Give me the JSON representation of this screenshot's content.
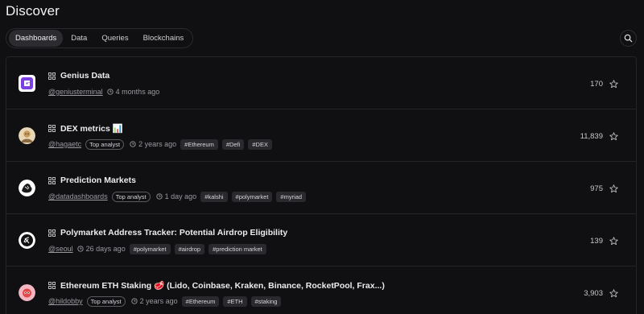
{
  "header": {
    "title": "Discover"
  },
  "tabs": [
    {
      "label": "Dashboards",
      "active": true
    },
    {
      "label": "Data",
      "active": false
    },
    {
      "label": "Queries",
      "active": false
    },
    {
      "label": "Blockchains",
      "active": false
    }
  ],
  "search": {
    "icon": "search-icon"
  },
  "rows": [
    {
      "name": "Genius Data",
      "user": "@geniusterminal",
      "badge": "",
      "time": "4 months ago",
      "tags": [],
      "stars": "170",
      "avatar_color": "#7b3fe4"
    },
    {
      "name": "DEX metrics 📊",
      "user": "@hagaetc",
      "badge": "Top analyst",
      "time": "2 years ago",
      "tags": [
        "#Ethereum",
        "#Defi",
        "#DEX"
      ],
      "stars": "11,839",
      "avatar_color": "#c79a5b"
    },
    {
      "name": "Prediction Markets",
      "user": "@datadashboards",
      "badge": "Top analyst",
      "time": "1 day ago",
      "tags": [
        "#kalshi",
        "#polymarket",
        "#myriad"
      ],
      "stars": "975",
      "avatar_color": "#ffffff"
    },
    {
      "name": "Polymarket Address Tracker: Potential Airdrop Eligibility",
      "user": "@seoul",
      "badge": "",
      "time": "26 days ago",
      "tags": [
        "#polymarket",
        "#airdrop",
        "#prediction market"
      ],
      "stars": "139",
      "avatar_color": "#ffffff"
    },
    {
      "name": "Ethereum ETH Staking 🥩 (Lido, Coinbase, Kraken, Binance, RocketPool, Frax...)",
      "user": "@hildobby",
      "badge": "Top analyst",
      "time": "2 years ago",
      "tags": [
        "#Ethereum",
        "#ETH",
        "#staking"
      ],
      "stars": "3,903",
      "avatar_color": "#f3b7c4"
    }
  ]
}
